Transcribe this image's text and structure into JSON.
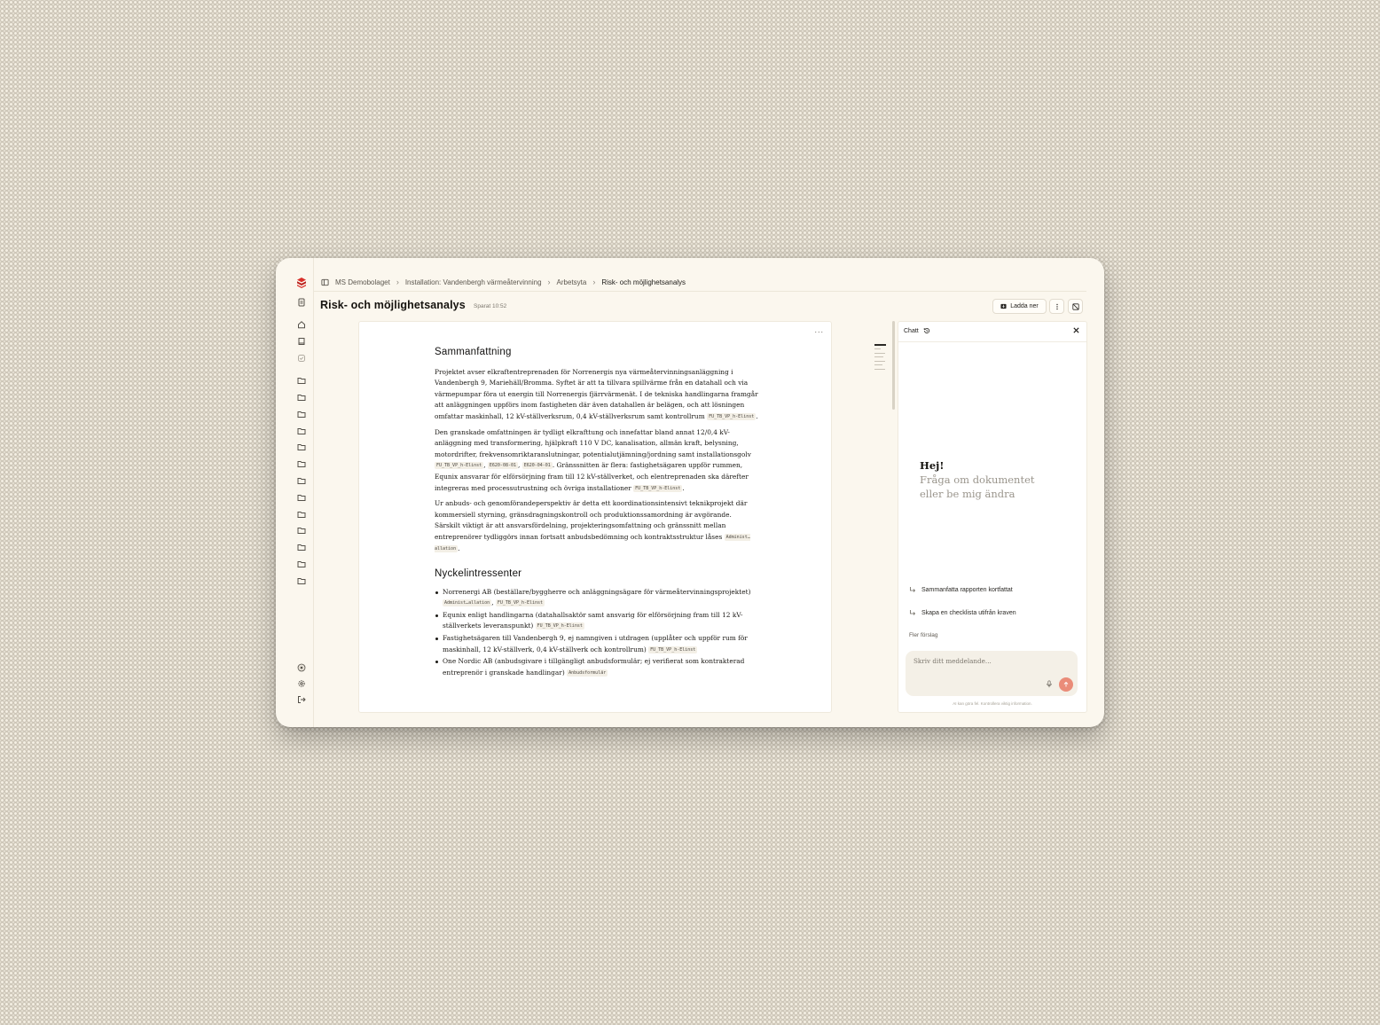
{
  "breadcrumb": [
    "MS Demobolaget",
    "Installation: Vandenbergh värmeåtervinning",
    "Arbetsyta",
    "Risk- och möjlighetsanalys"
  ],
  "page": {
    "title": "Risk- och möjlighetsanalys",
    "saved": "Sparat 10:52"
  },
  "toolbar": {
    "download_label": "Ladda ner"
  },
  "document": {
    "menu": "...",
    "summary_heading": "Sammanfattning",
    "p1": "Projektet avser elkraftentreprenaden för Norrenergis nya värmeåtervinningsanläggning i Vandenbergh 9, Mariehäll/Bromma. Syftet är att ta tillvara spillvärme från en datahall och via värmepumpar föra ut energin till Norrenergis fjärrvärmenät. I de tekniska handlingarna framgår att anläggningen uppförs inom fastigheten där även datahallen är belägen, och att lösningen omfattar maskinhall, 12 kV-ställverksrum, 0,4 kV-ställverksrum samt kontrollrum",
    "p1_ref": "FU_TB_VP_h-Elinst",
    "p2_a": "Den granskade omfattningen är tydligt elkrafttung och innefattar bland annat 12/0,4 kV-anläggning med transformering, hjälpkraft 110 V DC, kanalisation, allmän kraft, belysning, motordrifter, frekvensomriktaranslutningar, potentialutjämning/jordning samt installationsgolv",
    "p2_ref1": "FU_TB_VP_h-Elinst",
    "p2_ref2": "E620-08-01",
    "p2_ref3": "E620-04-01",
    "p2_b": ". Gränssnitten är flera: fastighetsägaren uppför rummen, Equnix ansvarar för elförsörjning fram till 12 kV-ställverket, och elentreprenaden ska därefter integreras med processutrustning och övriga installationer",
    "p2_ref4": "FU_TB_VP_h-Elinst",
    "p3": "Ur anbuds- och genomförandeperspektiv är detta ett koordinationsintensivt teknikprojekt där kommersiell styrning, gränsdragningskontroll och produktionssamordning är avgörande. Särskilt viktigt är att ansvarsfördelning, projekteringsomfattning och gränssnitt mellan entreprenörer tydliggörs innan fortsatt anbudsbedömning och kontraktsstruktur låses",
    "p3_ref": "Administ…allation",
    "stake_heading": "Nyckelintressenter",
    "stakeholders": [
      {
        "text": "Norrenergi AB (beställare/byggherre och anläggningsägare för värmeåtervinningsprojektet)",
        "ref1": "Administ…allation",
        "ref2": "FU_TB_VP_h-Elinst"
      },
      {
        "text": "Equnix enligt handlingarna (datahallsaktör samt ansvarig för elförsörjning fram till 12 kV-ställverkets leveranspunkt)",
        "ref1": "FU_TB_VP_h-Elinst"
      },
      {
        "text": "Fastighetsägaren till Vandenbergh 9, ej namngiven i utdragen (upplåter och uppför rum för maskinhall, 12 kV-ställverk, 0,4 kV-ställverk och kontrollrum)",
        "ref1": "FU_TB_VP_h-Elinst"
      },
      {
        "text": "One Nordic AB (anbudsgivare i tillgängligt anbudsformulär; ej verifierat som kontrakterad entreprenör i granskade handlingar)",
        "ref1": "Anbudsformulär"
      }
    ]
  },
  "chat": {
    "title": "Chatt",
    "greeting": "Hej!",
    "subtitle_1": "Fråga om dokumentet",
    "subtitle_2": "eller be mig ändra",
    "suggestions": [
      "Sammanfatta rapporten kortfattat",
      "Skapa en checklista utifrån kraven"
    ],
    "more_suggestions": "Fler förslag",
    "placeholder": "Skriv ditt meddelande...",
    "disclaimer": "AI kan göra fel. Kontrollera viktig information."
  },
  "colors": {
    "brand": "#d8302a",
    "send_button": "#ea8c79",
    "window_bg": "#fbf7ee"
  }
}
